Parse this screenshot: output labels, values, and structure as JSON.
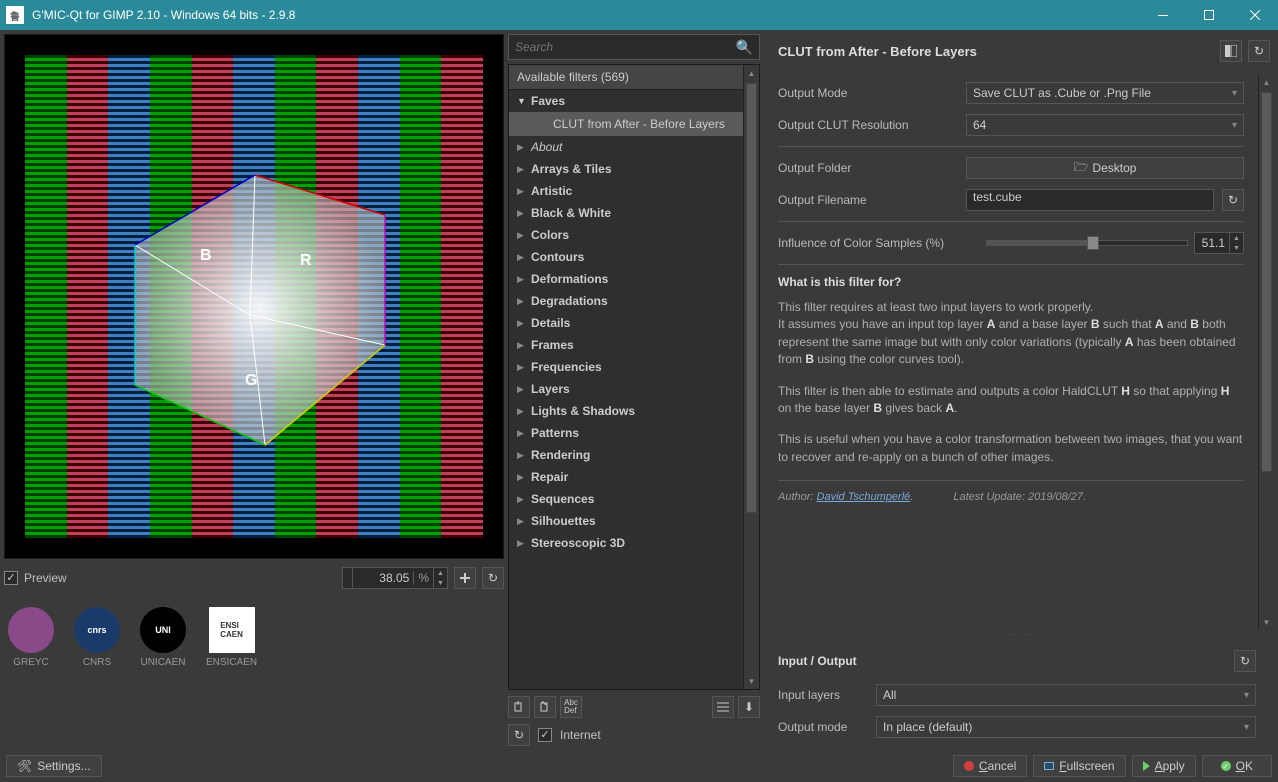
{
  "window": {
    "title": "G'MIC-Qt for GIMP 2.10 - Windows 64 bits - 2.9.8"
  },
  "preview": {
    "checkbox_label": "Preview",
    "zoom_value": "38.05",
    "zoom_suffix": "%"
  },
  "logos": [
    "GREYC",
    "CNRS",
    "UNICAEN",
    "ENSICAEN"
  ],
  "search": {
    "placeholder": "Search"
  },
  "tree": {
    "header": "Available filters (569)",
    "faves": "Faves",
    "selected_filter": "CLUT from After - Before Layers",
    "categories": [
      "About",
      "Arrays & Tiles",
      "Artistic",
      "Black & White",
      "Colors",
      "Contours",
      "Deformations",
      "Degradations",
      "Details",
      "Frames",
      "Frequencies",
      "Layers",
      "Lights & Shadows",
      "Patterns",
      "Rendering",
      "Repair",
      "Sequences",
      "Silhouettes",
      "Stereoscopic 3D"
    ]
  },
  "internet_label": "Internet",
  "filter": {
    "title": "CLUT from After - Before Layers",
    "output_mode_label": "Output Mode",
    "output_mode_value": "Save CLUT as .Cube or .Png File",
    "clut_res_label": "Output CLUT Resolution",
    "clut_res_value": "64",
    "folder_label": "Output Folder",
    "folder_value": "Desktop",
    "filename_label": "Output Filename",
    "filename_value": "test.cube",
    "influence_label": "Influence of Color Samples (%)",
    "influence_value": "51.1",
    "section_q": "What is this filter for?",
    "author_label": "Author:",
    "author_name": "David Tschumperlé",
    "author_dot": ".",
    "update_label": "Latest Update:",
    "update_value": "2019/08/27."
  },
  "io": {
    "title": "Input / Output",
    "input_label": "Input layers",
    "input_value": "All",
    "output_label": "Output mode",
    "output_value": "In place (default)"
  },
  "buttons": {
    "settings": "Settings...",
    "cancel": "Cancel",
    "fullscreen": "Fullscreen",
    "apply": "Apply",
    "ok": "OK",
    "cancel_u": "C",
    "cancel_r": "ancel",
    "full_u": "F",
    "full_r": "ullscreen",
    "apply_u": "A",
    "apply_r": "pply",
    "ok_u": "O",
    "ok_r": "K"
  }
}
